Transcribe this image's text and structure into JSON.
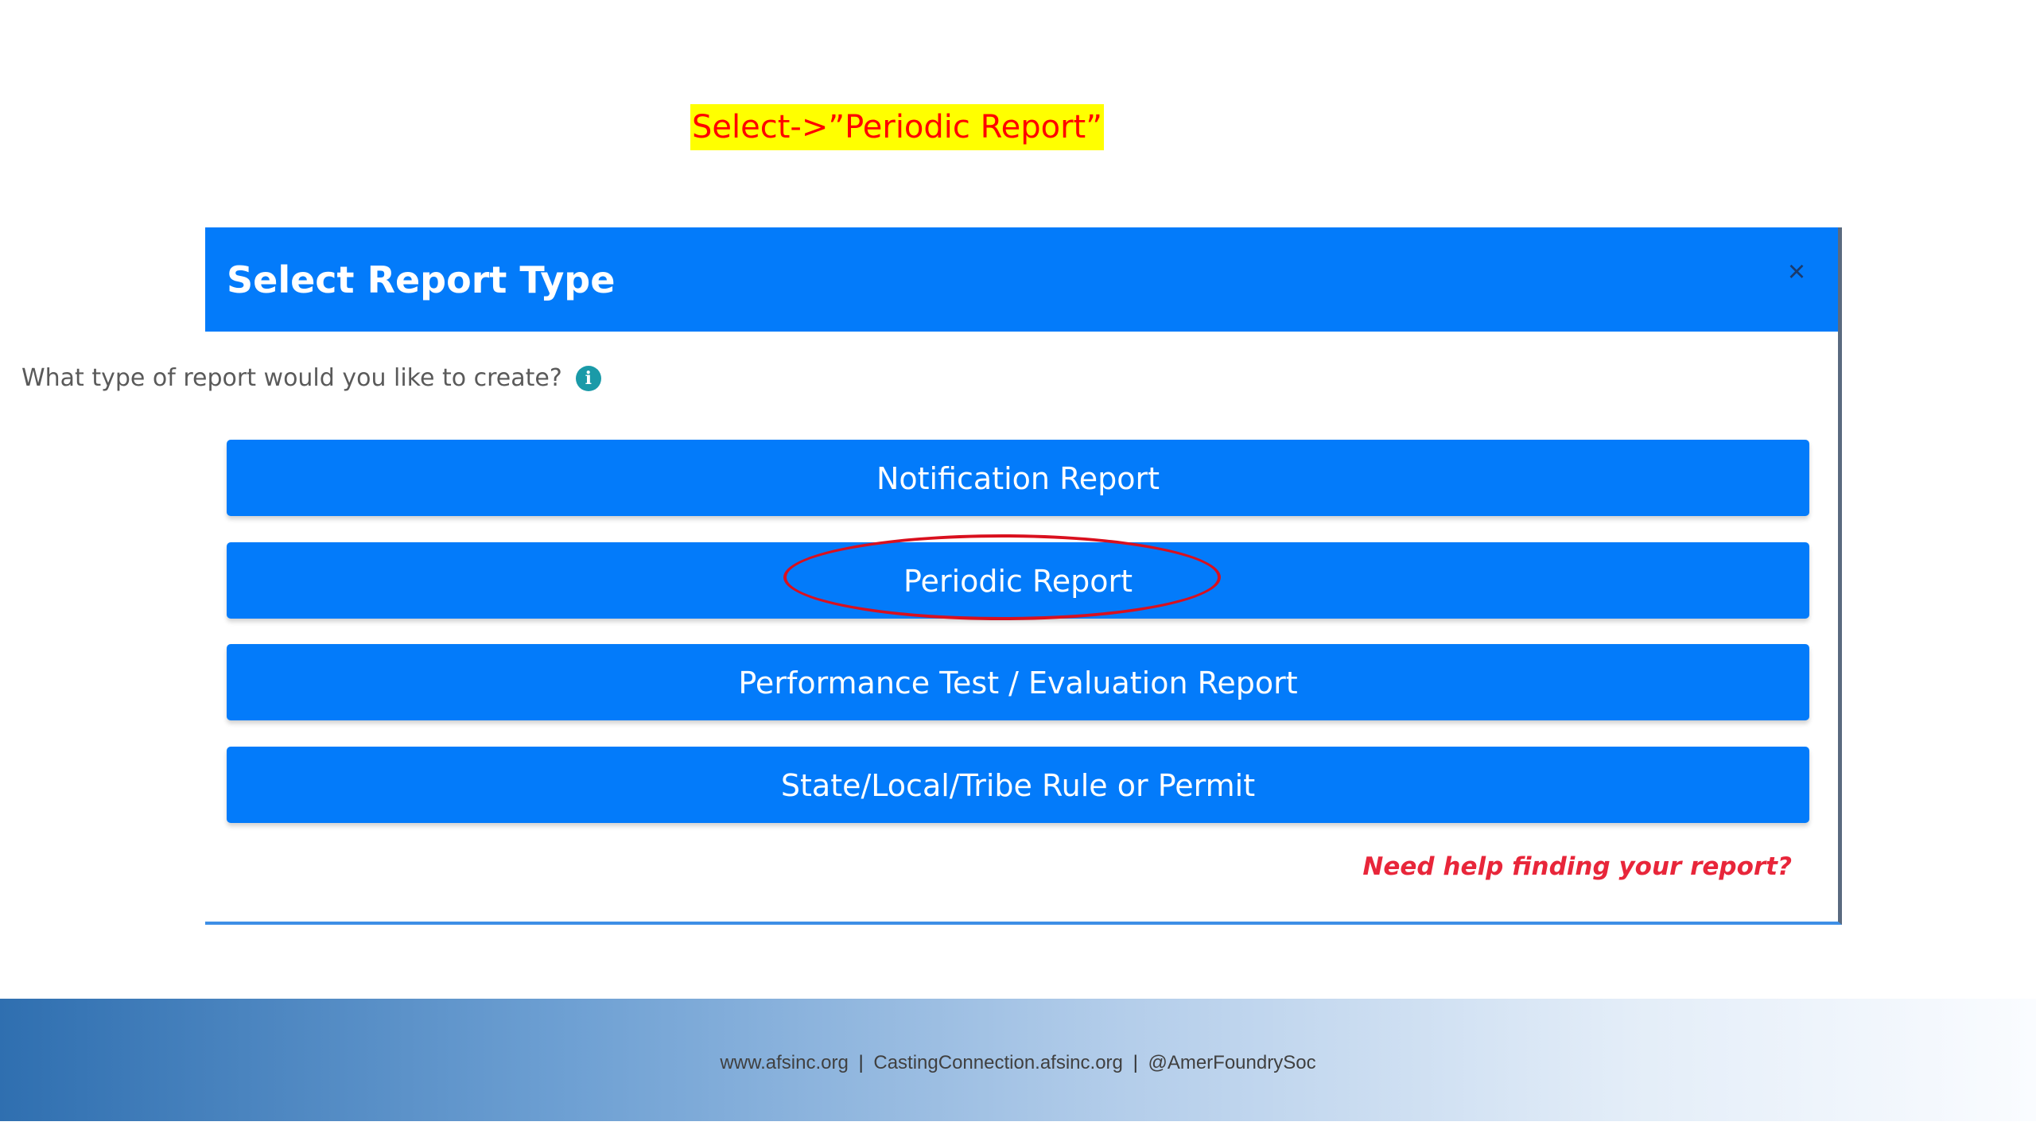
{
  "instruction": {
    "text": "Select->”Periodic Report”"
  },
  "dialog": {
    "title": "Select Report Type",
    "close_symbol": "×",
    "prompt": "What type of report would you like to create?",
    "info_icon": "info-icon",
    "buttons": [
      {
        "label": "Notification Report"
      },
      {
        "label": "Periodic Report"
      },
      {
        "label": "Performance Test / Evaluation Report"
      },
      {
        "label": "State/Local/Tribe Rule or Permit"
      }
    ],
    "help_link": "Need help finding your report?"
  },
  "footer": {
    "site": "www.afsinc.org",
    "separator": "|",
    "casting": "CastingConnection.afsinc.org",
    "social": "@AmerFoundrySoc"
  },
  "colors": {
    "primary_blue": "#037bfa",
    "highlight_yellow": "#ffff00",
    "instruction_red": "#ff0000",
    "ellipse_red": "#d9101e",
    "help_link_red": "#e8263a",
    "info_teal": "#1a9aa8"
  }
}
